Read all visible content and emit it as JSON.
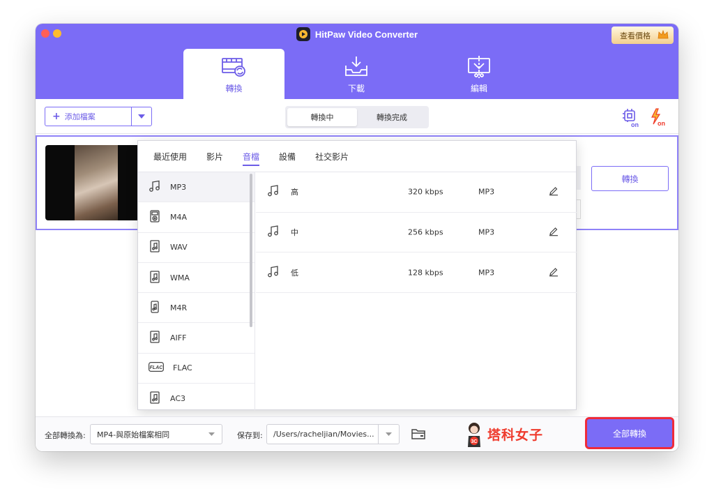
{
  "app": {
    "title": "HitPaw Video Converter",
    "price_button": "查看價格"
  },
  "tabs": [
    {
      "label": "轉換",
      "icon": "film-convert-icon",
      "active": true
    },
    {
      "label": "下載",
      "icon": "download-tray-icon",
      "active": false
    },
    {
      "label": "編輯",
      "icon": "edit-crop-icon",
      "active": false
    }
  ],
  "toolbar": {
    "add_files": "添加檔案",
    "segment": [
      "轉換中",
      "轉換完成"
    ],
    "hardware_accel_label": "on",
    "speed_label": "on"
  },
  "file_card": {
    "convert_button": "轉換"
  },
  "format_popup": {
    "tabs": [
      "最近使用",
      "影片",
      "音檔",
      "設備",
      "社交影片"
    ],
    "active_tab": "音檔",
    "formats": [
      {
        "label": "MP3",
        "icon": "music-note-icon"
      },
      {
        "label": "M4A",
        "icon": "ipod-icon"
      },
      {
        "label": "WAV",
        "icon": "audio-file-icon"
      },
      {
        "label": "WMA",
        "icon": "audio-file-icon"
      },
      {
        "label": "M4R",
        "icon": "phone-audio-icon"
      },
      {
        "label": "AIFF",
        "icon": "audio-file-icon"
      },
      {
        "label": "FLAC",
        "icon": "flac-icon"
      },
      {
        "label": "AC3",
        "icon": "audio-file-icon"
      }
    ],
    "selected_format": "MP3",
    "qualities": [
      {
        "name": "高",
        "bitrate": "320 kbps",
        "format": "MP3"
      },
      {
        "name": "中",
        "bitrate": "256 kbps",
        "format": "MP3"
      },
      {
        "name": "低",
        "bitrate": "128 kbps",
        "format": "MP3"
      }
    ]
  },
  "footer": {
    "convert_all_label": "全部轉換為:",
    "convert_all_value": "MP4-與原始檔案相同",
    "save_to_label": "保存到:",
    "save_to_value": "/Users/racheljian/Movies...",
    "watermark_text": "塔科女子",
    "watermark_badge": "3C",
    "convert_all_button": "全部轉換"
  },
  "colors": {
    "accent": "#7b6cf6",
    "accent_dark": "#6c5ce7",
    "highlight": "#ef2b3a",
    "brand_red": "#ef3b2d"
  }
}
